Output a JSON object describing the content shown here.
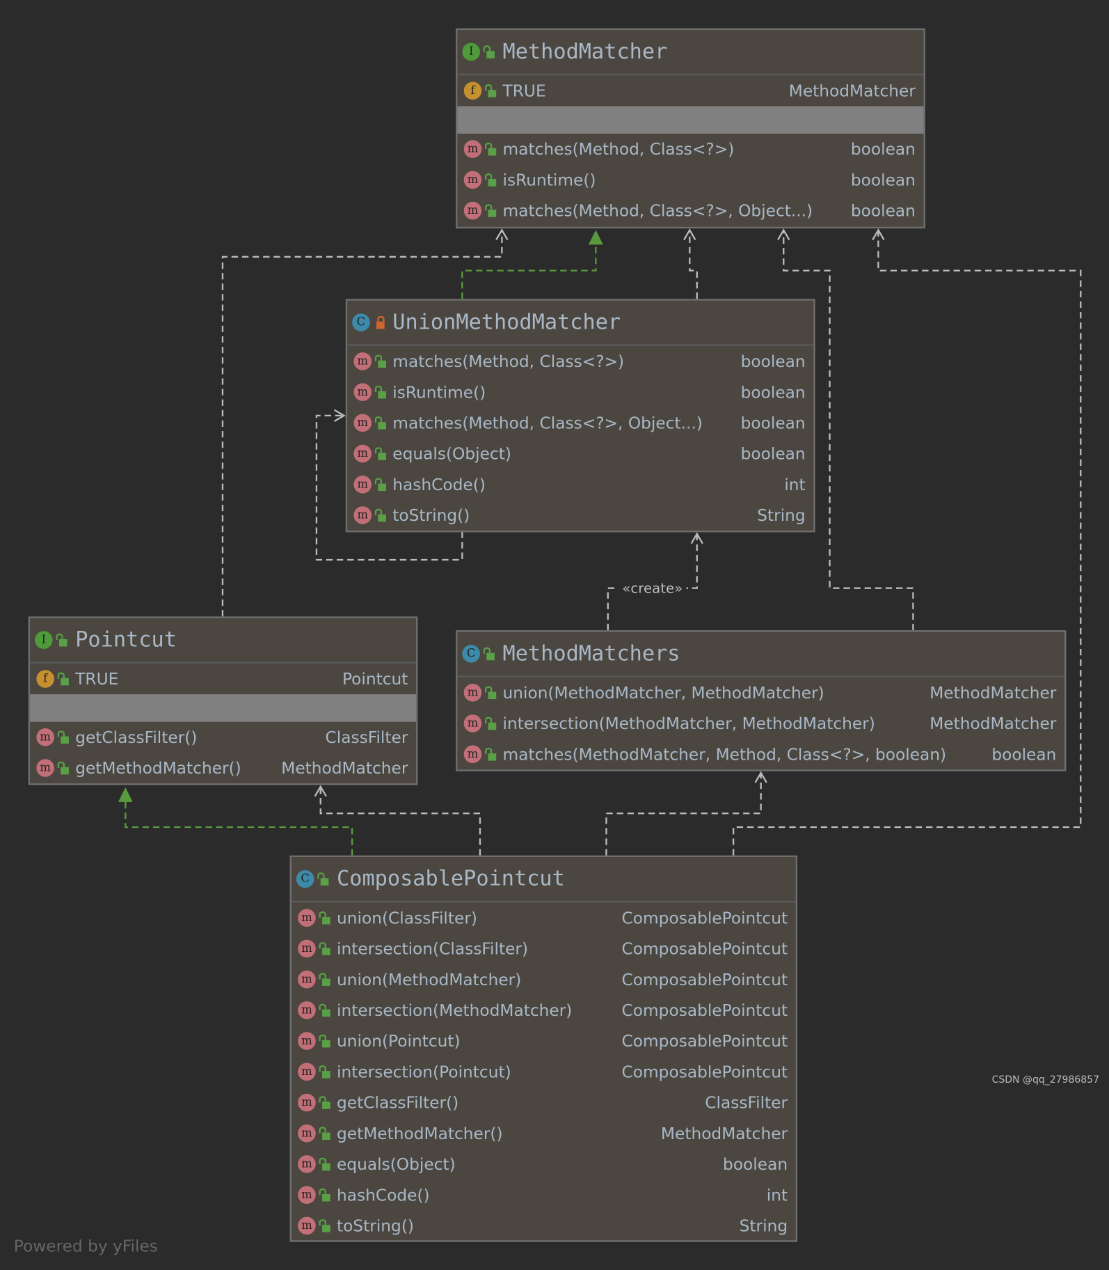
{
  "colors": {
    "background": "#2b2b2b",
    "box": "#4b4740",
    "dependency_edge": "#bbbbbb",
    "realization_edge": "#5a9a3f"
  },
  "classes": [
    {
      "id": "MethodMatcher",
      "kind": "I",
      "title": "MethodMatcher",
      "fields": [
        {
          "name": "TRUE",
          "type": "MethodMatcher"
        }
      ],
      "methods": [
        {
          "name": "matches(Method, Class<?>)",
          "type": "boolean"
        },
        {
          "name": "isRuntime()",
          "type": "boolean"
        },
        {
          "name": "matches(Method, Class<?>, Object...)",
          "type": "boolean"
        }
      ]
    },
    {
      "id": "UnionMethodMatcher",
      "kind": "C",
      "private": true,
      "title": "UnionMethodMatcher",
      "fields": null,
      "methods": [
        {
          "name": "matches(Method, Class<?>)",
          "type": "boolean"
        },
        {
          "name": "isRuntime()",
          "type": "boolean"
        },
        {
          "name": "matches(Method, Class<?>, Object...)",
          "type": "boolean"
        },
        {
          "name": "equals(Object)",
          "type": "boolean"
        },
        {
          "name": "hashCode()",
          "type": "int"
        },
        {
          "name": "toString()",
          "type": "String"
        }
      ]
    },
    {
      "id": "Pointcut",
      "kind": "I",
      "title": "Pointcut",
      "fields": [
        {
          "name": "TRUE",
          "type": "Pointcut"
        }
      ],
      "methods": [
        {
          "name": "getClassFilter()",
          "type": "ClassFilter"
        },
        {
          "name": "getMethodMatcher()",
          "type": "MethodMatcher"
        }
      ]
    },
    {
      "id": "MethodMatchers",
      "kind": "C",
      "title": "MethodMatchers",
      "fields": null,
      "methods": [
        {
          "name": "union(MethodMatcher, MethodMatcher)",
          "type": "MethodMatcher"
        },
        {
          "name": "intersection(MethodMatcher, MethodMatcher)",
          "type": "MethodMatcher"
        },
        {
          "name": "matches(MethodMatcher, Method, Class<?>, boolean)",
          "type": "boolean"
        }
      ]
    },
    {
      "id": "ComposablePointcut",
      "kind": "C",
      "title": "ComposablePointcut",
      "fields": null,
      "methods": [
        {
          "name": "union(ClassFilter)",
          "type": "ComposablePointcut"
        },
        {
          "name": "intersection(ClassFilter)",
          "type": "ComposablePointcut"
        },
        {
          "name": "union(MethodMatcher)",
          "type": "ComposablePointcut"
        },
        {
          "name": "intersection(MethodMatcher)",
          "type": "ComposablePointcut"
        },
        {
          "name": "union(Pointcut)",
          "type": "ComposablePointcut"
        },
        {
          "name": "intersection(Pointcut)",
          "type": "ComposablePointcut"
        },
        {
          "name": "getClassFilter()",
          "type": "ClassFilter"
        },
        {
          "name": "getMethodMatcher()",
          "type": "MethodMatcher"
        },
        {
          "name": "equals(Object)",
          "type": "boolean"
        },
        {
          "name": "hashCode()",
          "type": "int"
        },
        {
          "name": "toString()",
          "type": "String"
        }
      ]
    }
  ],
  "edges": [
    {
      "from": "Pointcut",
      "to": "MethodMatcher",
      "kind": "dependency"
    },
    {
      "from": "UnionMethodMatcher",
      "to": "MethodMatcher",
      "kind": "realization"
    },
    {
      "from": "UnionMethodMatcher",
      "to": "MethodMatcher",
      "kind": "dependency"
    },
    {
      "from": "MethodMatchers",
      "to": "MethodMatcher",
      "kind": "dependency"
    },
    {
      "from": "ComposablePointcut",
      "to": "MethodMatcher",
      "kind": "dependency"
    },
    {
      "from": "UnionMethodMatcher",
      "to": "UnionMethodMatcher",
      "kind": "dependency"
    },
    {
      "from": "MethodMatchers",
      "to": "UnionMethodMatcher",
      "kind": "dependency",
      "label": "«create»"
    },
    {
      "from": "ComposablePointcut",
      "to": "Pointcut",
      "kind": "realization"
    },
    {
      "from": "ComposablePointcut",
      "to": "Pointcut",
      "kind": "dependency"
    },
    {
      "from": "ComposablePointcut",
      "to": "MethodMatchers",
      "kind": "dependency"
    }
  ],
  "footer": "Powered by yFiles",
  "watermark": "CSDN @qq_27986857"
}
